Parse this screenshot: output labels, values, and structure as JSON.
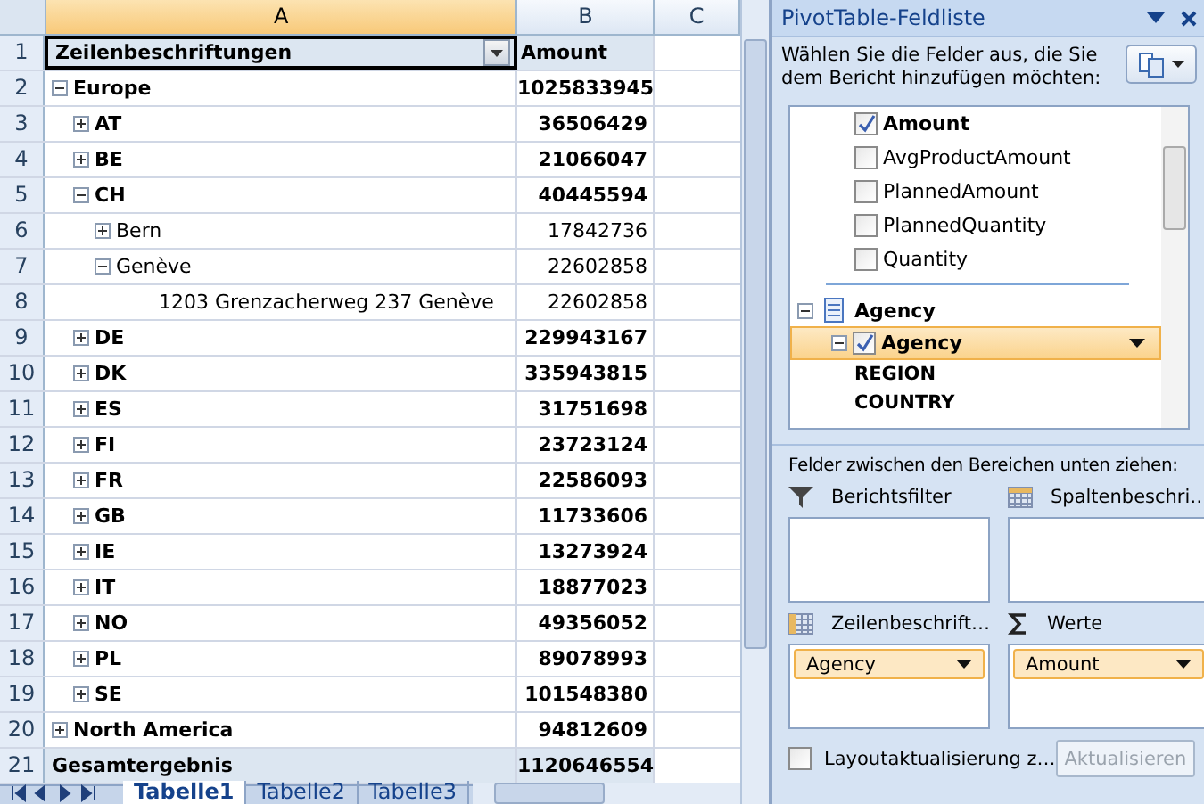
{
  "sheet": {
    "columns": [
      {
        "label": "A",
        "selected": true
      },
      {
        "label": "B",
        "selected": false
      },
      {
        "label": "C",
        "selected": false
      }
    ],
    "header_row": {
      "row": "1",
      "label": "Zeilenbeschriftungen",
      "value": "Amount"
    },
    "rows": [
      {
        "row": "2",
        "label": "Europe",
        "amount": "1025833945",
        "expanded": true,
        "children": [
          {
            "row": "3",
            "label": "AT",
            "amount": "36506429",
            "expanded": false
          },
          {
            "row": "4",
            "label": "BE",
            "amount": "21066047",
            "expanded": false
          },
          {
            "row": "5",
            "label": "CH",
            "amount": "40445594",
            "expanded": true,
            "children": [
              {
                "row": "6",
                "label": "Bern",
                "amount": "17842736",
                "expanded": false
              },
              {
                "row": "7",
                "label": "Genève",
                "amount": "22602858",
                "expanded": true,
                "children": [
                  {
                    "row": "8",
                    "label": "1203 Grenzacherweg 237 Genève",
                    "amount": "22602858"
                  }
                ]
              }
            ]
          },
          {
            "row": "9",
            "label": "DE",
            "amount": "229943167",
            "expanded": false
          },
          {
            "row": "10",
            "label": "DK",
            "amount": "335943815",
            "expanded": false
          },
          {
            "row": "11",
            "label": "ES",
            "amount": "31751698",
            "expanded": false
          },
          {
            "row": "12",
            "label": "FI",
            "amount": "23723124",
            "expanded": false
          },
          {
            "row": "13",
            "label": "FR",
            "amount": "22586093",
            "expanded": false
          },
          {
            "row": "14",
            "label": "GB",
            "amount": "11733606",
            "expanded": false
          },
          {
            "row": "15",
            "label": "IE",
            "amount": "13273924",
            "expanded": false
          },
          {
            "row": "16",
            "label": "IT",
            "amount": "18877023",
            "expanded": false
          },
          {
            "row": "17",
            "label": "NO",
            "amount": "49356052",
            "expanded": false
          },
          {
            "row": "18",
            "label": "PL",
            "amount": "89078993",
            "expanded": false
          },
          {
            "row": "19",
            "label": "SE",
            "amount": "101548380",
            "expanded": false
          }
        ]
      },
      {
        "row": "20",
        "label": "North America",
        "amount": "94812609",
        "expanded": false
      }
    ],
    "total": {
      "row": "21",
      "label": "Gesamtergebnis",
      "amount": "1120646554"
    },
    "tabs": [
      {
        "label": "Tabelle1",
        "selected": true
      },
      {
        "label": "Tabelle2",
        "selected": false
      },
      {
        "label": "Tabelle3",
        "selected": false
      }
    ]
  },
  "pane": {
    "title": "PivotTable-Feldliste",
    "instruction": "Wählen Sie die Felder aus, die Sie dem Bericht hinzufügen möchten:",
    "fields": [
      {
        "label": "Amount",
        "checked": true
      },
      {
        "label": "AvgProductAmount",
        "checked": false
      },
      {
        "label": "PlannedAmount",
        "checked": false
      },
      {
        "label": "PlannedQuantity",
        "checked": false
      },
      {
        "label": "Quantity",
        "checked": false
      }
    ],
    "dimension": {
      "label": "Agency",
      "expanded": true,
      "hierarchy": {
        "label": "Agency",
        "expanded": true,
        "checked": true,
        "selected": true,
        "levels": [
          "REGION",
          "COUNTRY"
        ]
      }
    },
    "drag_hint": "Felder zwischen den Bereichen unten ziehen:",
    "areas": [
      {
        "kind": "filter",
        "title": "Berichtsfilter"
      },
      {
        "kind": "columns",
        "title": "Spaltenbeschri…"
      },
      {
        "kind": "rows",
        "title": "Zeilenbeschrift…",
        "chips": [
          "Agency"
        ]
      },
      {
        "kind": "values",
        "title": "Werte",
        "chips": [
          "Amount"
        ]
      }
    ],
    "defer_update": {
      "label": "Layoutaktualisierung z…",
      "checked": false
    },
    "update_button": {
      "label": "Aktualisieren",
      "disabled": true
    }
  }
}
